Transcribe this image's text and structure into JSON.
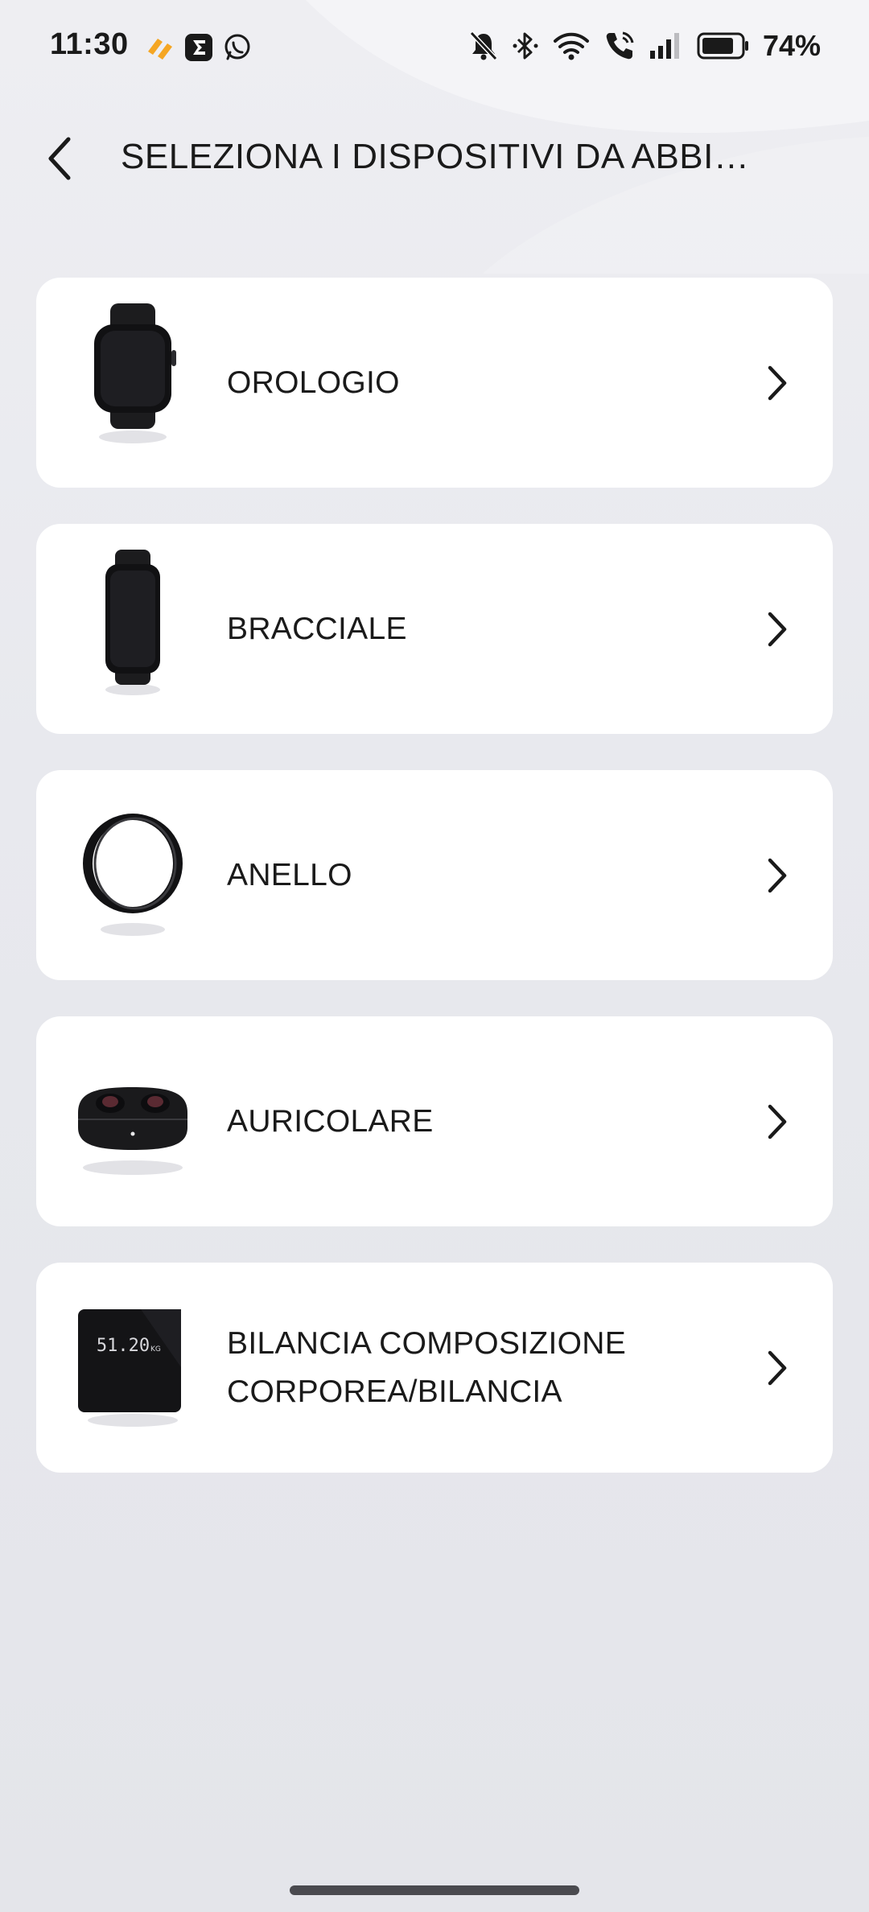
{
  "status_bar": {
    "time": "11:30",
    "battery": "74%",
    "icons": [
      "app-orange-icon",
      "sigma-app-icon",
      "whatsapp-icon",
      "mute-icon",
      "bluetooth-icon",
      "wifi-icon",
      "call-icon",
      "signal-icon",
      "battery-icon"
    ]
  },
  "header": {
    "back_icon": "chevron-left-icon",
    "title": "SELEZIONA I DISPOSITIVI DA ABBI…"
  },
  "devices": [
    {
      "label": "OROLOGIO",
      "icon": "watch-icon"
    },
    {
      "label": "BRACCIALE",
      "icon": "band-icon"
    },
    {
      "label": "ANELLO",
      "icon": "ring-icon"
    },
    {
      "label": "AURICOLARE",
      "icon": "earbuds-icon"
    },
    {
      "label": "BILANCIA COMPOSIZIONE CORPOREA/BILANCIA",
      "icon": "scale-icon",
      "scale_reading": "51.20",
      "scale_unit": "KG"
    }
  ],
  "colors": {
    "background": "#e6e7ec",
    "card": "#ffffff",
    "text": "#1a1a1a",
    "accent_app": "#f5a623"
  }
}
